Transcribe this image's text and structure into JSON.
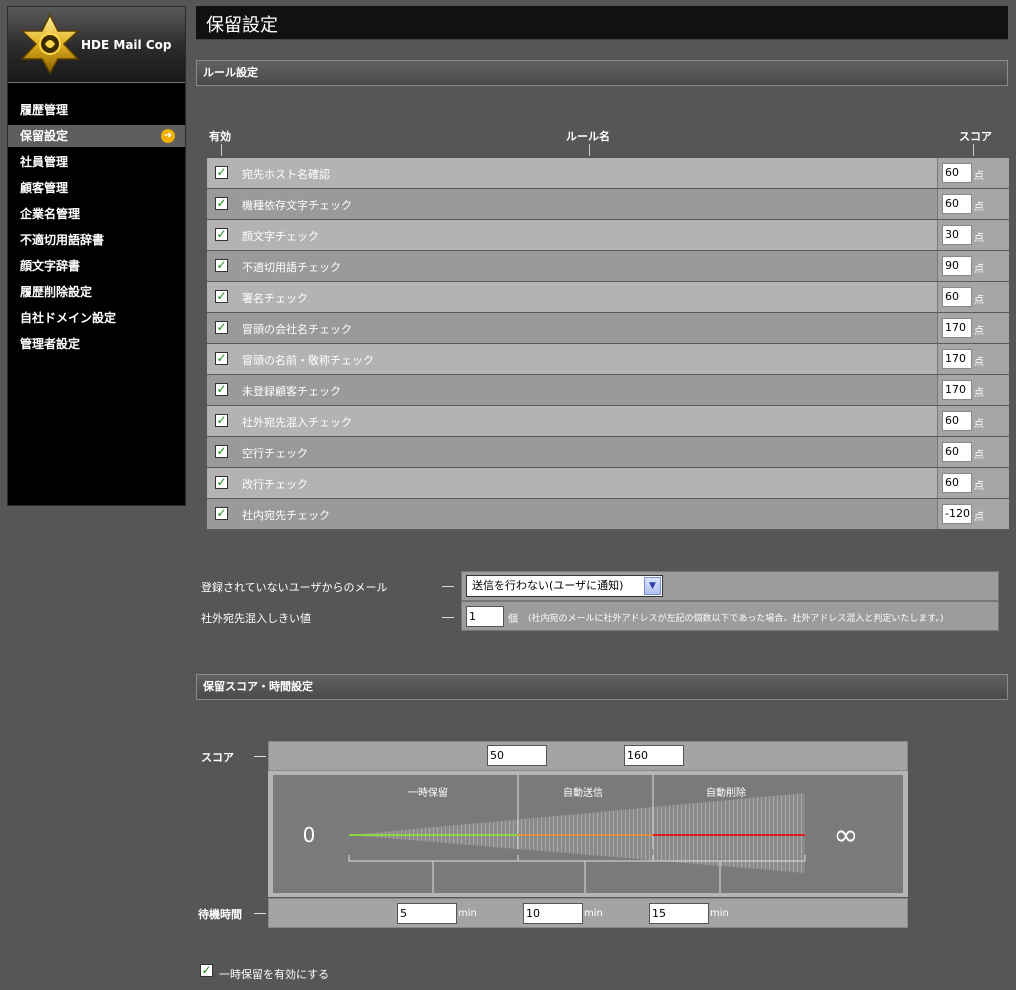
{
  "app": {
    "name": "HDE Mail Cop"
  },
  "sidebar": {
    "items": [
      {
        "label": "履歴管理",
        "active": false
      },
      {
        "label": "保留設定",
        "active": true
      },
      {
        "label": "社員管理",
        "active": false
      },
      {
        "label": "顧客管理",
        "active": false
      },
      {
        "label": "企業名管理",
        "active": false
      },
      {
        "label": "不適切用語辞書",
        "active": false
      },
      {
        "label": "顔文字辞書",
        "active": false
      },
      {
        "label": "履歴削除設定",
        "active": false
      },
      {
        "label": "自社ドメイン設定",
        "active": false
      },
      {
        "label": "管理者設定",
        "active": false
      }
    ]
  },
  "page": {
    "title": "保留設定"
  },
  "rule_section": {
    "title": "ルール設定",
    "col_enabled": "有効",
    "col_name": "ルール名",
    "col_score": "スコア",
    "unit": "点",
    "rules": [
      {
        "name": "宛先ホスト名確認",
        "score": "60",
        "enabled": true
      },
      {
        "name": "機種依存文字チェック",
        "score": "60",
        "enabled": true
      },
      {
        "name": "顔文字チェック",
        "score": "30",
        "enabled": true
      },
      {
        "name": "不適切用語チェック",
        "score": "90",
        "enabled": true
      },
      {
        "name": "署名チェック",
        "score": "60",
        "enabled": true
      },
      {
        "name": "冒頭の会社名チェック",
        "score": "170",
        "enabled": true
      },
      {
        "name": "冒頭の名前・敬称チェック",
        "score": "170",
        "enabled": true
      },
      {
        "name": "未登録顧客チェック",
        "score": "170",
        "enabled": true
      },
      {
        "name": "社外宛先混入チェック",
        "score": "60",
        "enabled": true
      },
      {
        "name": "空行チェック",
        "score": "60",
        "enabled": true
      },
      {
        "name": "改行チェック",
        "score": "60",
        "enabled": true
      },
      {
        "name": "社内宛先チェック",
        "score": "-120",
        "enabled": true
      }
    ]
  },
  "options": {
    "unregistered_label": "登録されていないユーザからのメール",
    "unregistered_value": "送信を行わない(ユーザに通知)",
    "threshold_label": "社外宛先混入しきい値",
    "threshold_value": "1",
    "threshold_unit": "個",
    "threshold_note": "(社内宛のメールに社外アドレスが左記の個数以下であった場合、社外アドレス混入と判定いたします。)"
  },
  "hold_section": {
    "title": "保留スコア・時間設定",
    "score_label": "スコア",
    "score_low": "50",
    "score_high": "160",
    "zero": "0",
    "infinity": "∞",
    "zone_hold": "一時保留",
    "zone_send": "自動送信",
    "zone_delete": "自動削除",
    "wait_label": "待機時間",
    "wait1": "5",
    "wait2": "10",
    "wait3": "15",
    "min_unit": "min",
    "colors": {
      "hold": "#8ad83a",
      "send": "#e09040",
      "delete": "#e02020"
    },
    "enable_label": "一時保留を有効にする",
    "enable_checked": true
  }
}
